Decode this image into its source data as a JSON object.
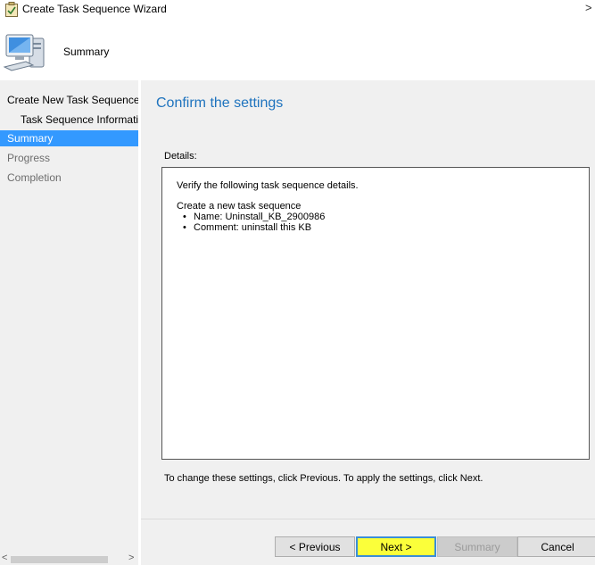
{
  "window": {
    "title": "Create Task Sequence Wizard",
    "close_glyph": ">"
  },
  "header": {
    "title": "Summary",
    "icon": "computer-icon"
  },
  "nav": {
    "items": [
      {
        "label": "Create New Task Sequence",
        "state": "normal"
      },
      {
        "label": "Task Sequence Information",
        "state": "normal"
      },
      {
        "label": "Summary",
        "state": "selected"
      },
      {
        "label": "Progress",
        "state": "disabled"
      },
      {
        "label": "Completion",
        "state": "disabled"
      }
    ],
    "scroll_left": "<",
    "scroll_right": ">"
  },
  "main": {
    "heading": "Confirm the settings",
    "details_label": "Details:",
    "details": {
      "intro": "Verify the following task sequence details.",
      "section_title": "Create a new task sequence",
      "bullets": [
        "Name: Uninstall_KB_2900986",
        "Comment: uninstall this KB"
      ]
    },
    "hint": "To change these settings, click Previous. To apply the settings, click Next."
  },
  "buttons": {
    "previous": "< Previous",
    "next": "Next >",
    "summary": "Summary",
    "cancel": "Cancel"
  },
  "colors": {
    "heading": "#1e73be",
    "selected_nav": "#3399ff",
    "next_highlight": "#fbff3a"
  }
}
